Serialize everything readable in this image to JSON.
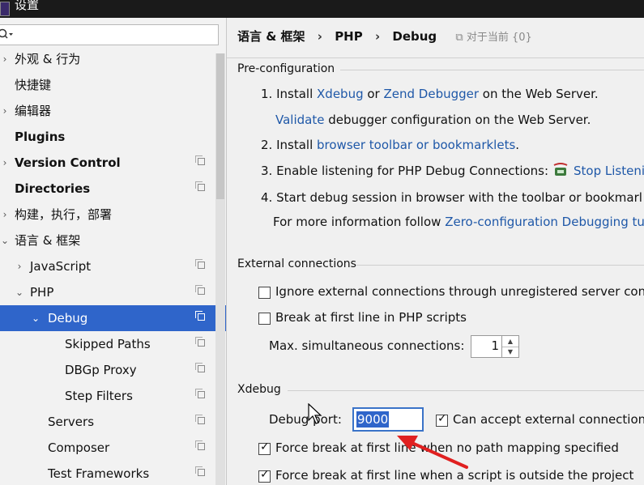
{
  "window": {
    "title": "设置"
  },
  "search": {
    "placeholder": "",
    "value": ""
  },
  "sidebar": {
    "items": [
      {
        "label": "外观 & 行为",
        "arrow": "›"
      },
      {
        "label": "快捷键"
      },
      {
        "label": "编辑器",
        "arrow": "›"
      },
      {
        "label": "Plugins"
      },
      {
        "label": "Version Control",
        "arrow": "›"
      },
      {
        "label": "Directories"
      },
      {
        "label": "构建，执行，部署",
        "arrow": "›"
      },
      {
        "label": "语言 & 框架",
        "arrow": "⌄"
      },
      {
        "label": "JavaScript",
        "arrow": "›"
      },
      {
        "label": "PHP",
        "arrow": "⌄"
      },
      {
        "label": "Debug",
        "arrow": "⌄"
      },
      {
        "label": "Skipped Paths"
      },
      {
        "label": "DBGp Proxy"
      },
      {
        "label": "Step Filters"
      },
      {
        "label": "Servers"
      },
      {
        "label": "Composer"
      },
      {
        "label": "Test Frameworks"
      }
    ]
  },
  "breadcrumb": {
    "items": [
      "语言 & 框架",
      "PHP",
      "Debug"
    ],
    "separator": "›",
    "note": "⧉ 对于当前 {0}"
  },
  "preconfig": {
    "title": "Pre-configuration",
    "step1_prefix": "1. Install ",
    "xdebug_link": "Xdebug",
    "or": " or ",
    "zend_link": "Zend Debugger",
    "step1_suffix": " on the Web Server.",
    "validate_link": "Validate",
    "validate_suffix": " debugger configuration on the Web Server.",
    "step2_prefix": "2. Install ",
    "toolbar_link": "browser toolbar or bookmarklets",
    "step2_suffix": ".",
    "step3_prefix": "3. Enable listening for PHP Debug Connections: ",
    "stop_link": "Stop Listeni",
    "step4": "4. Start debug session in browser with the toolbar or bookmarl",
    "more_prefix": "For more information follow ",
    "zero_link": "Zero-configuration Debugging tu"
  },
  "external": {
    "title": "External connections",
    "ignore_label": "Ignore external connections through unregistered server con",
    "ignore_checked": false,
    "break_label": "Break at first line in PHP scripts",
    "break_checked": false,
    "max_label": "Max. simultaneous connections:",
    "max_value": "1"
  },
  "xdebug": {
    "title": "Xdebug",
    "port_label": "Debug port:",
    "port_value": "9000",
    "accept_label": "Can accept external connections",
    "accept_checked": true,
    "force_path_label": "Force break at first line when no path mapping specified",
    "force_path_checked": true,
    "force_outside_label": "Force break at first line when a script is outside the project",
    "force_outside_checked": true
  },
  "colors": {
    "selection": "#2f65ca",
    "link": "#1f58a8",
    "annotation_arrow": "#e02020"
  }
}
